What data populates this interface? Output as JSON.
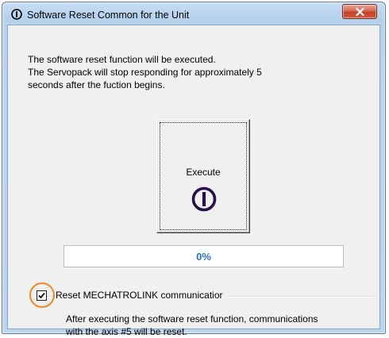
{
  "window": {
    "title": "Software Reset Common for the Unit",
    "title_icon": "power-icon",
    "close_icon": "close-icon",
    "accent_close": "#c3412b"
  },
  "message": {
    "line1": "The software reset function will be executed.",
    "line2": "The Servopack will stop responding for approximately 5",
    "line3": "seconds after the fuction begins."
  },
  "execute_button": {
    "label": "Execute",
    "icon": "power-icon",
    "icon_color": "#2b0f4a"
  },
  "progress": {
    "value": 0,
    "text": "0%",
    "text_color": "#1e72d4"
  },
  "reset_option": {
    "checked": true,
    "label": "Reset MECHATROLINK communicatior",
    "highlight_color": "#f08a1e",
    "note_line1": "After executing the software reset function, communications",
    "note_line2": "with the axis #5 will be reset."
  }
}
